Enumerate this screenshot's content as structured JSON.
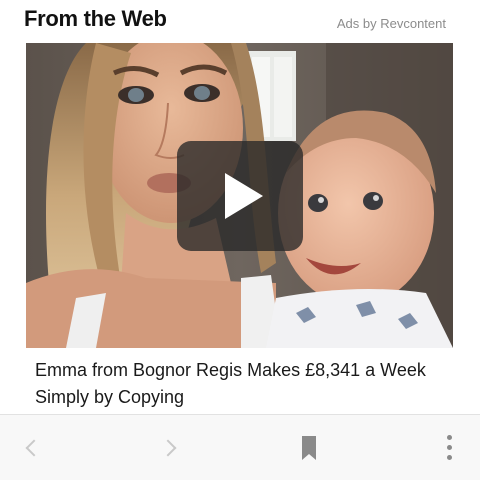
{
  "widget": {
    "title": "From the Web",
    "ads_label": "Ads by Revcontent"
  },
  "article": {
    "headline": "Emma from Bognor Regis Makes £8,341 a Week Simply by Copying",
    "thumbnail_icon": "photo-woman-with-baby",
    "play_icon": "play-icon"
  },
  "toolbar": {
    "back_icon": "chevron-left-icon",
    "forward_icon": "chevron-right-icon",
    "bookmark_icon": "bookmark-icon",
    "more_icon": "more-vertical-icon"
  },
  "colors": {
    "title": "#111111",
    "ads_label": "#8c8c8c",
    "headline": "#1a1a1a",
    "toolbar_bg": "#f8f8f8",
    "disabled_icon": "#c9c9c9",
    "active_icon": "#8a8a8a",
    "play_overlay": "#282828"
  }
}
